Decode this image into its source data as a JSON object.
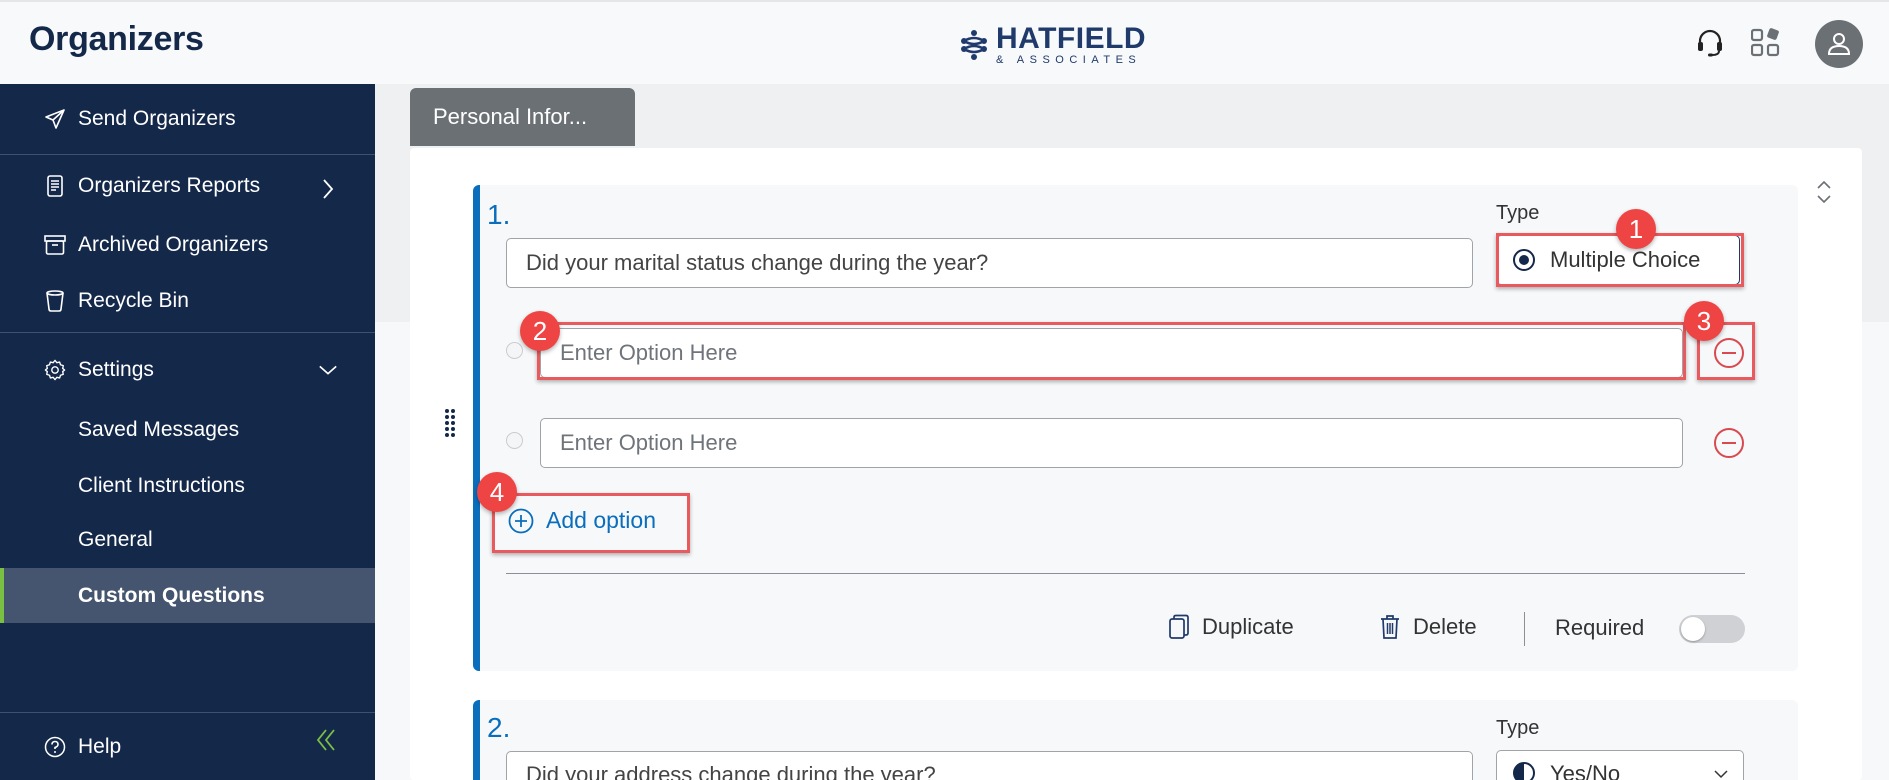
{
  "header": {
    "app_title": "Organizers",
    "logo": {
      "main": "HATFIELD",
      "sub": "& ASSOCIATES"
    },
    "icons": [
      "headset-icon",
      "apps-icon",
      "user-avatar-icon"
    ]
  },
  "sidebar": {
    "items": [
      {
        "label": "Send Organizers",
        "icon": "send-icon"
      },
      {
        "label": "Organizers Reports",
        "icon": "report-icon",
        "chevron": "chevron-right-icon"
      },
      {
        "label": "Archived Organizers",
        "icon": "archive-icon"
      },
      {
        "label": "Recycle Bin",
        "icon": "recycle-bin-icon"
      },
      {
        "label": "Settings",
        "icon": "gear-icon",
        "chevron": "chevron-down-icon",
        "expanded": true
      }
    ],
    "settings_subitems": [
      {
        "label": "Saved Messages"
      },
      {
        "label": "Client Instructions"
      },
      {
        "label": "General"
      },
      {
        "label": "Custom Questions",
        "active": true
      }
    ],
    "footer": {
      "help_label": "Help",
      "collapse_icon": "double-chevron-left-icon"
    },
    "accent_color": "#7ac143"
  },
  "main": {
    "section_tab": "Personal Infor...",
    "questions": [
      {
        "number": "1.",
        "text": "Did your marital status change during the year?",
        "type_label": "Type",
        "type_value": "Multiple Choice",
        "type_icon": "radio-selected-icon",
        "options": [
          {
            "placeholder": "Enter Option Here",
            "value": ""
          },
          {
            "placeholder": "Enter Option Here",
            "value": ""
          }
        ],
        "add_option_label": "Add option",
        "actions": {
          "duplicate": "Duplicate",
          "delete": "Delete",
          "required": "Required",
          "required_on": false
        }
      },
      {
        "number": "2.",
        "text": "Did your address change during the year?",
        "type_label": "Type",
        "type_value": "Yes/No",
        "type_icon": "half-circle-icon"
      }
    ]
  },
  "annotations": [
    {
      "label": "1",
      "target": "type-select"
    },
    {
      "label": "2",
      "target": "option-input-1"
    },
    {
      "label": "3",
      "target": "remove-option-button-1"
    },
    {
      "label": "4",
      "target": "add-option-button"
    }
  ],
  "colors": {
    "navy": "#14284a",
    "accent_blue": "#0a6ebd",
    "remove_red": "#d84a4f",
    "annotation_red": "#ef4444"
  }
}
